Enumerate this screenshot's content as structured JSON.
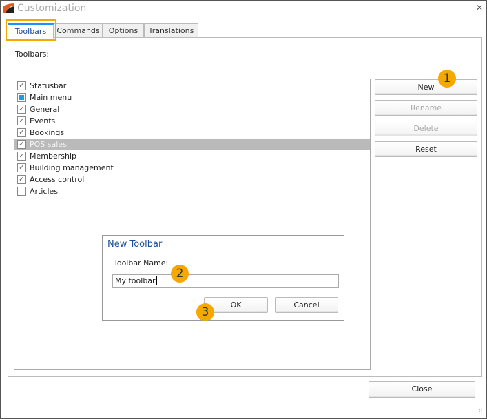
{
  "window": {
    "title": "Customization"
  },
  "tabs": [
    {
      "label": "Toolbars",
      "active": true
    },
    {
      "label": "Commands"
    },
    {
      "label": "Options"
    },
    {
      "label": "Translations"
    }
  ],
  "toolbars_label": "Toolbars:",
  "toolbars": [
    {
      "label": "Statusbar",
      "state": "checked"
    },
    {
      "label": "Main menu",
      "state": "indeterminate"
    },
    {
      "label": "General",
      "state": "checked"
    },
    {
      "label": "Events",
      "state": "checked"
    },
    {
      "label": "Bookings",
      "state": "checked"
    },
    {
      "label": "POS sales",
      "state": "checked",
      "selected": true
    },
    {
      "label": "Membership",
      "state": "checked"
    },
    {
      "label": "Building management",
      "state": "checked"
    },
    {
      "label": "Access control",
      "state": "checked"
    },
    {
      "label": "Articles",
      "state": "unchecked"
    }
  ],
  "buttons": {
    "new": "New",
    "rename": "Rename",
    "delete": "Delete",
    "reset": "Reset",
    "close": "Close"
  },
  "dialog": {
    "title": "New Toolbar",
    "name_label": "Toolbar Name:",
    "name_value": "My toolbar",
    "ok": "OK",
    "cancel": "Cancel"
  },
  "badges": [
    "1",
    "2",
    "3"
  ],
  "colors": {
    "accent": "#1e90ff",
    "highlight": "#f5a800",
    "selection": "#bababa"
  }
}
